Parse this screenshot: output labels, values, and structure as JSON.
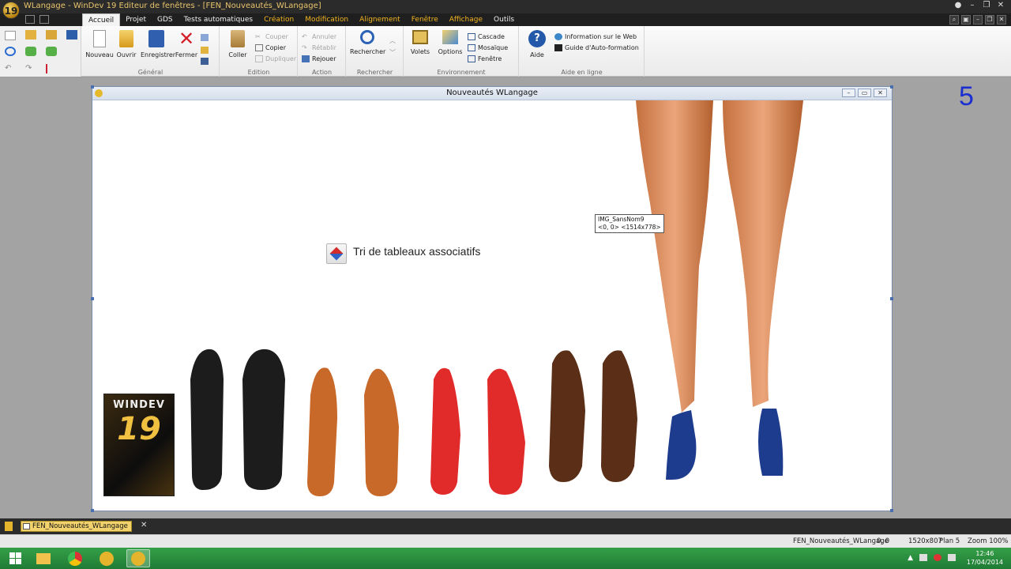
{
  "window": {
    "title": "WLangage - WinDev 19  Editeur de fenêtres - [FEN_Nouveautés_WLangage]",
    "logo_text": "19"
  },
  "menu": {
    "items": [
      "Accueil",
      "Projet",
      "GDS",
      "Tests automatiques",
      "Création",
      "Modification",
      "Alignement",
      "Fenêtre",
      "Affichage",
      "Outils"
    ]
  },
  "ribbon": {
    "general": {
      "label": "Général",
      "nouveau": "Nouveau",
      "ouvrir": "Ouvrir",
      "enregistrer": "Enregistrer",
      "fermer": "Fermer"
    },
    "edition": {
      "label": "Edition",
      "coller": "Coller",
      "couper": "Couper",
      "copier": "Copier",
      "dupliquer": "Dupliquer"
    },
    "action": {
      "label": "Action",
      "annuler": "Annuler",
      "retablir": "Rétablir",
      "rejouer": "Rejouer"
    },
    "rechercher": {
      "label": "Rechercher",
      "rechercher": "Rechercher"
    },
    "environnement": {
      "label": "Environnement",
      "volets": "Volets",
      "options": "Options",
      "cascade": "Cascade",
      "mosaique": "Mosaïque",
      "fenetre": "Fenêtre"
    },
    "aide": {
      "label": "Aide en ligne",
      "aide": "Aide",
      "info_web": "Information sur le Web",
      "guide": "Guide d'Auto-formation"
    }
  },
  "workspace": {
    "plan_number": "5"
  },
  "form": {
    "title": "Nouveautés WLangage",
    "static_label": "Tri de tableaux associatifs",
    "tooltip_line1": "IMG_SansNom9",
    "tooltip_line2": "<0, 0> <1514x778>",
    "product_box_text": "WINDEV",
    "product_box_number": "19"
  },
  "doc_tab": {
    "label": "FEN_Nouveautés_WLangage"
  },
  "statusbar": {
    "document": "FEN_Nouveautés_WLangage",
    "position": "0, 0",
    "size": "1520x807",
    "plan": "Plan 5",
    "zoom": "Zoom 100%"
  },
  "taskbar": {
    "time": "12:46",
    "date": "17/04/2014"
  },
  "colors": {
    "accent_orange": "#f2b51f",
    "plan_blue": "#1b2fd1",
    "taskbar_green": "#2a8c3e"
  }
}
